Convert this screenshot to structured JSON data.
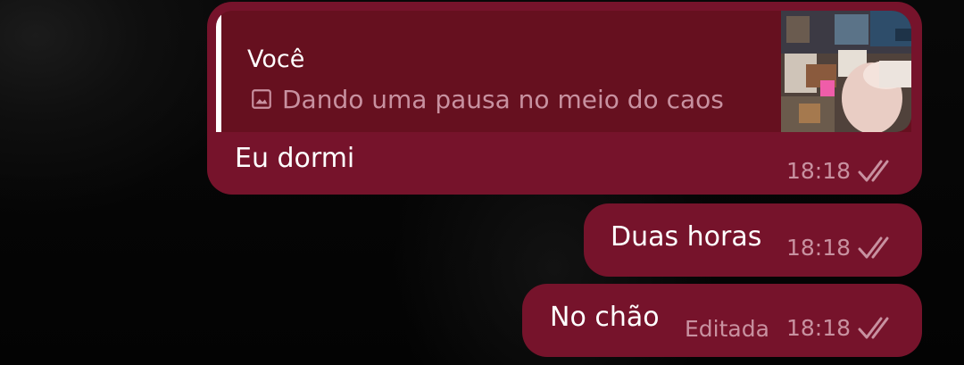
{
  "chat": {
    "messages": [
      {
        "reply_to": {
          "author": "Você",
          "text": "Dando uma pausa no meio do caos"
        },
        "text": "Eu dormi",
        "time": "18:18",
        "status_icon": "double-check-icon"
      },
      {
        "text": "Duas horas",
        "time": "18:18",
        "status_icon": "double-check-icon"
      },
      {
        "text": "No chão",
        "edited_label": "Editada",
        "time": "18:18",
        "status_icon": "double-check-icon"
      }
    ]
  },
  "colors": {
    "bubble": "#76132b",
    "quote_background": "#66101f",
    "quote_bar": "#ffffff",
    "meta_text": "#c891a0",
    "text": "#ffffff",
    "background": "#050505"
  }
}
